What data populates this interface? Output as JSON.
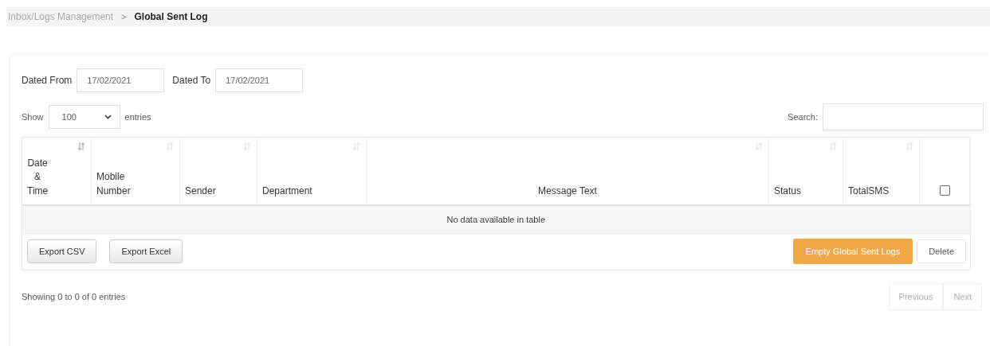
{
  "breadcrumb": {
    "parent": "Inbox/Logs Management",
    "separator": ">",
    "current": "Global Sent Log"
  },
  "filters": {
    "from_label": "Dated From",
    "from_value": "17/02/2021",
    "to_label": "Dated To",
    "to_value": "17/02/2021"
  },
  "length": {
    "show_label": "Show",
    "value": "100",
    "entries_label": "entries"
  },
  "search": {
    "label": "Search:"
  },
  "table": {
    "columns": [
      {
        "kind": "sort",
        "label": "Date\n&\nTime",
        "sort_active": true
      },
      {
        "kind": "sort",
        "label": "Mobile\nNumber",
        "sort_active": false
      },
      {
        "kind": "sort",
        "label": "Sender",
        "sort_active": false
      },
      {
        "kind": "sort",
        "label": "Department",
        "sort_active": false
      },
      {
        "kind": "sort",
        "label": "Message Text",
        "sort_active": false
      },
      {
        "kind": "sort",
        "label": "Status",
        "sort_active": false
      },
      {
        "kind": "sort",
        "label": "TotalSMS",
        "sort_active": false
      },
      {
        "kind": "checkbox",
        "checked": false
      }
    ],
    "empty_message": "No data available in table"
  },
  "buttons": [
    {
      "kind": "default",
      "label": "Export CSV"
    },
    {
      "kind": "default",
      "label": "Export Excel"
    },
    {
      "kind": "spacer"
    },
    {
      "kind": "warning",
      "label": "Empty Global Sent Logs"
    },
    {
      "kind": "plain",
      "label": "Delete"
    }
  ],
  "info": "Showing 0 to 0 of 0 entries",
  "pagination": [
    {
      "label": "Previous",
      "disabled": true
    },
    {
      "label": "Next",
      "disabled": true
    }
  ]
}
